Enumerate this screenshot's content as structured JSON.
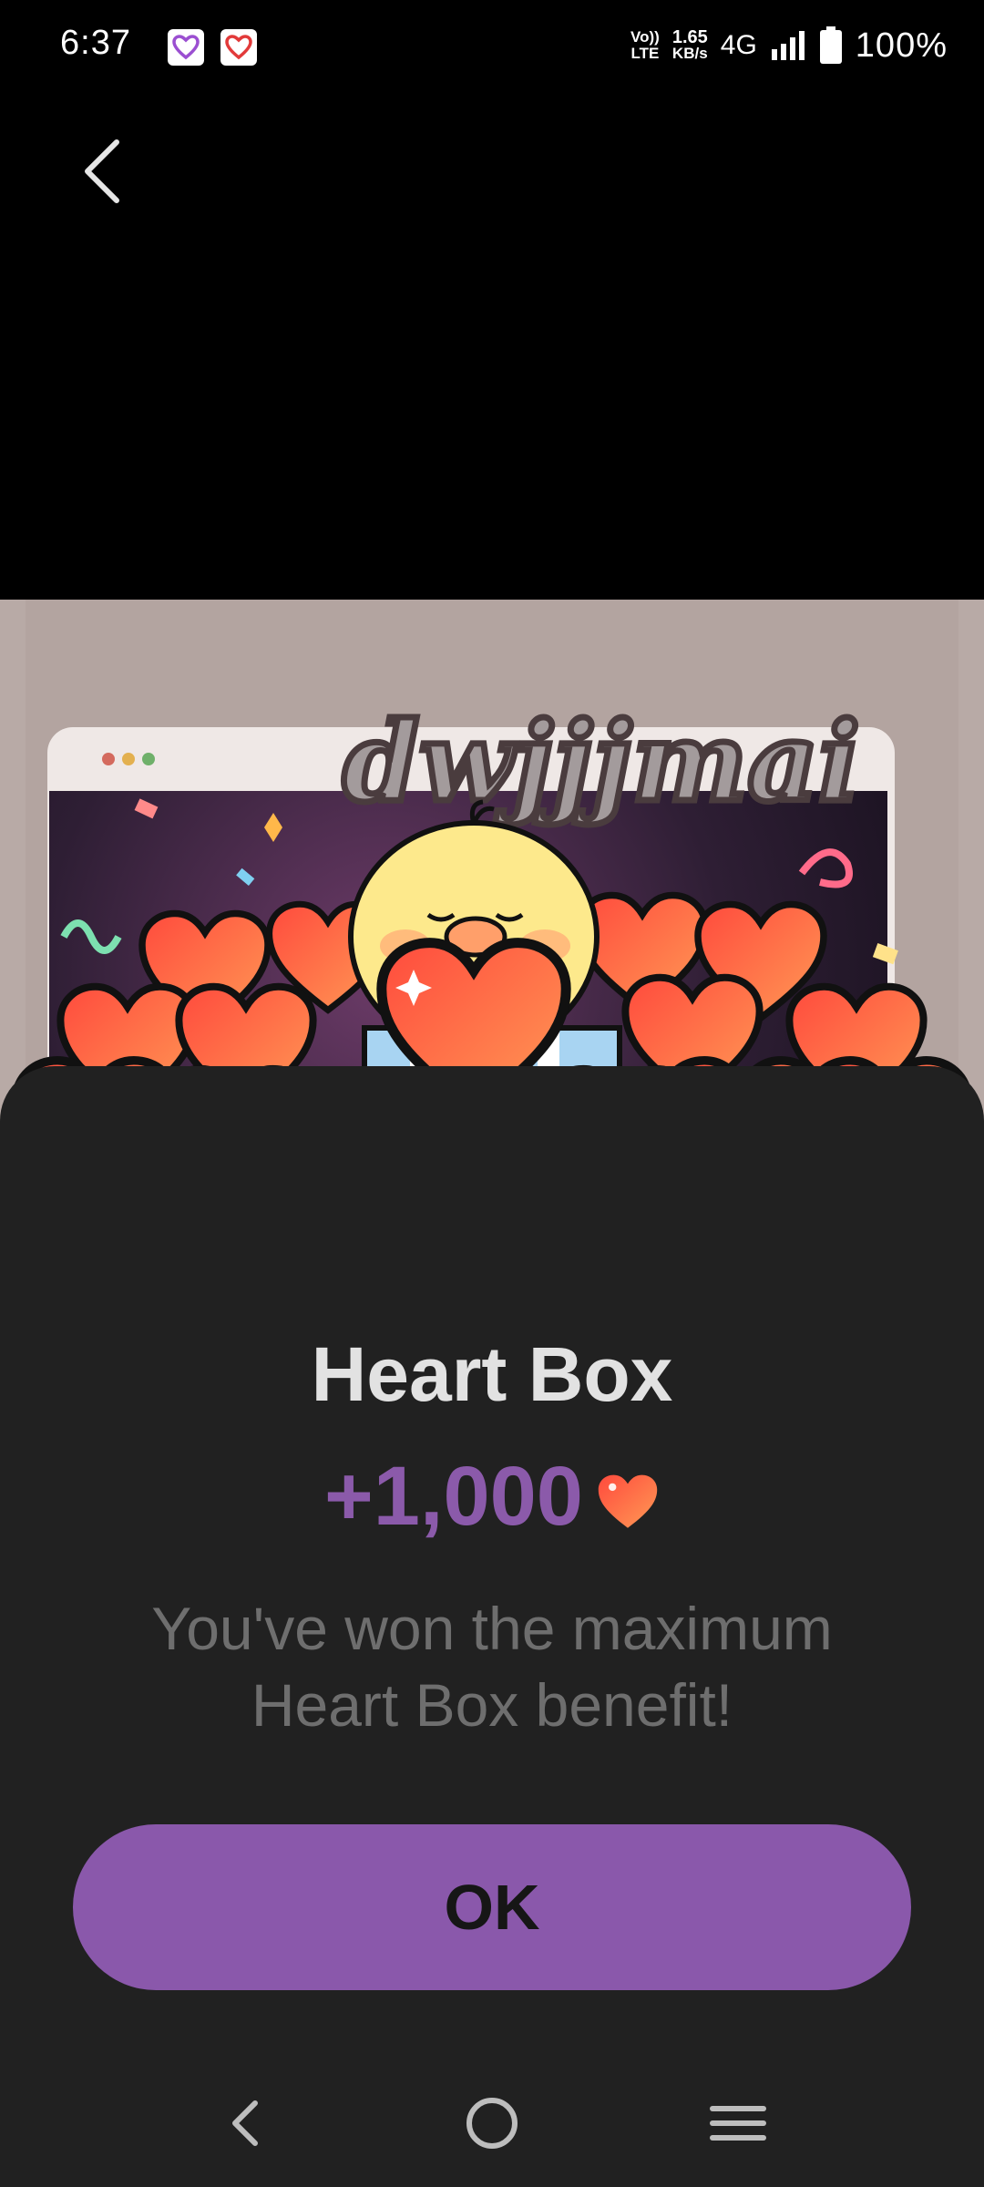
{
  "status_bar": {
    "time": "6:37",
    "volte_line1": "Vo))",
    "volte_line2": "LTE",
    "speed_value": "1.65",
    "speed_unit": "KB/s",
    "network": "4G",
    "battery": "100%",
    "icons": [
      "heart-app-icon",
      "heart-app-icon",
      "signal-icon",
      "battery-icon"
    ]
  },
  "banner": {
    "logo_text": "dwjjjmai"
  },
  "dialog": {
    "title": "Heart Box",
    "reward_amount": "+1,000",
    "message": "You've won the maximum Heart Box benefit!",
    "ok_label": "OK"
  },
  "colors": {
    "accent": "#8a58ab",
    "reward_text": "#8b5aaa",
    "sheet_bg": "#212121",
    "heart": "#ff5f45"
  },
  "nav": {
    "icons": [
      "back-icon",
      "home-icon",
      "menu-icon"
    ]
  }
}
